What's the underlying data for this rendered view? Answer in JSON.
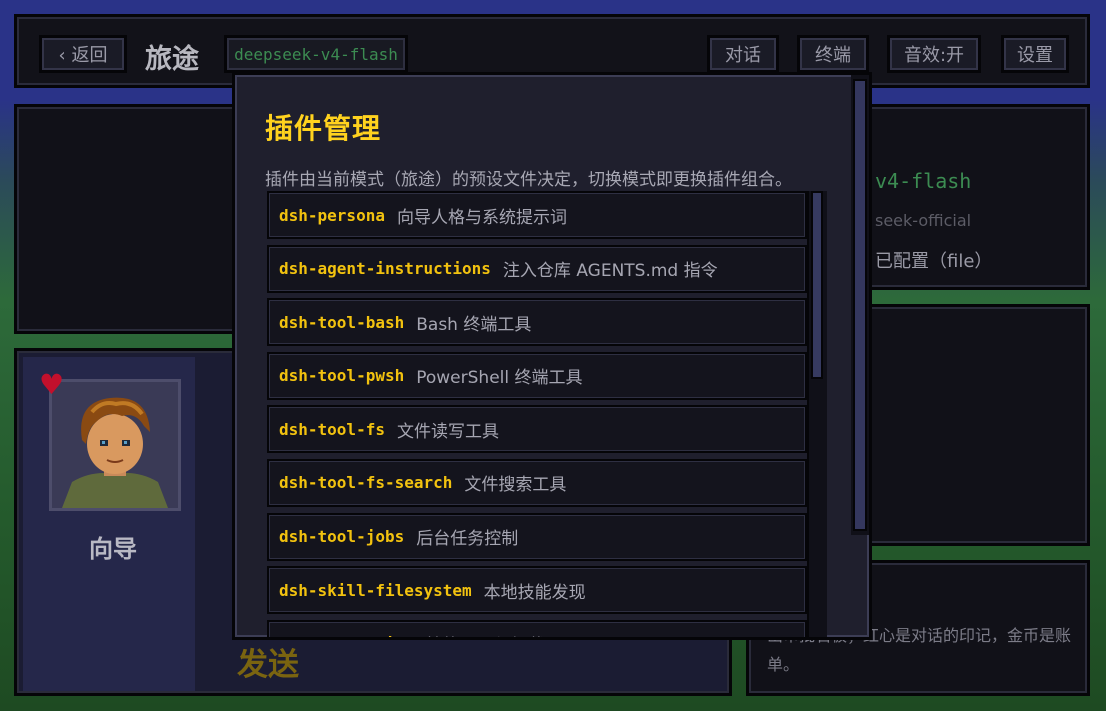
{
  "topbar": {
    "back_label": "‹ 返回",
    "title": "旅途",
    "model": "deepseek-v4-flash",
    "chat_label": "对话",
    "terminal_label": "终端",
    "sfx_label": "音效:开",
    "settings_label": "设置"
  },
  "character": {
    "name": "向导",
    "send_label": "发送"
  },
  "right_panel": {
    "model_partial": "v4-flash",
    "provider_partial": "seek-official",
    "config_partial": "已配置（file）",
    "hint_partial": "出审批石板；红心是对话的印记，金币是账单。"
  },
  "modal": {
    "title": "插件管理",
    "description": "插件由当前模式（旅途）的预设文件决定，切换模式即更换插件组合。",
    "plugins": [
      {
        "name": "dsh-persona",
        "desc": "向导人格与系统提示词"
      },
      {
        "name": "dsh-agent-instructions",
        "desc": "注入仓库 AGENTS.md 指令"
      },
      {
        "name": "dsh-tool-bash",
        "desc": "Bash 终端工具"
      },
      {
        "name": "dsh-tool-pwsh",
        "desc": "PowerShell 终端工具"
      },
      {
        "name": "dsh-tool-fs",
        "desc": "文件读写工具"
      },
      {
        "name": "dsh-tool-fs-search",
        "desc": "文件搜索工具"
      },
      {
        "name": "dsh-tool-jobs",
        "desc": "后台任务控制"
      },
      {
        "name": "dsh-skill-filesystem",
        "desc": "本地技能发现"
      },
      {
        "name": "dsh-tool-skill",
        "desc": "技能目录与加载工具"
      }
    ]
  },
  "colors": {
    "accent_yellow": "#ffd21e",
    "model_green": "#3c8c52",
    "heart_red": "#c2102c"
  }
}
